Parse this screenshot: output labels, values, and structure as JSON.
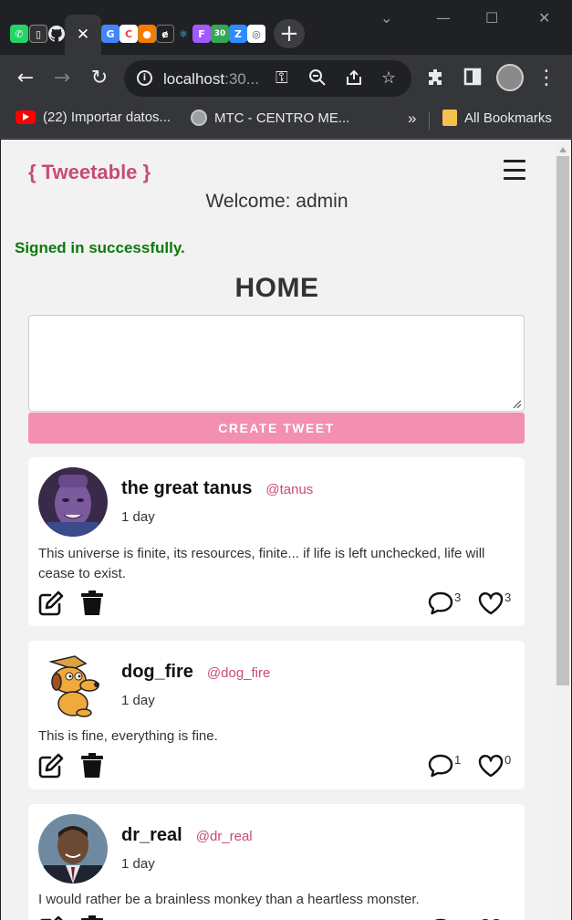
{
  "browser": {
    "active_tab_close": "✕",
    "new_tab": "+",
    "url_main": "localhost",
    "url_rest": ":30...",
    "bookmarks": [
      {
        "label": "(22) Importar datos..."
      },
      {
        "label": "MTC - CENTRO ME..."
      }
    ],
    "bookmarks_more": "»",
    "all_bookmarks": "All Bookmarks"
  },
  "app": {
    "brand": "{ Tweetable }",
    "welcome_prefix": "Welcome: ",
    "username": "admin",
    "flash": "Signed in successfully.",
    "page_title": "HOME",
    "tweet_input_value": "",
    "create_label": "CREATE TWEET"
  },
  "tweets": [
    {
      "name": "the great tanus",
      "handle": "@tanus",
      "age": "1 day",
      "body": "This universe is finite, its resources, finite... if life is left unchecked, life will cease to exist.",
      "comments": "3",
      "likes": "3"
    },
    {
      "name": "dog_fire",
      "handle": "@dog_fire",
      "age": "1 day",
      "body": "This is fine, everything is fine.",
      "comments": "1",
      "likes": "0"
    },
    {
      "name": "dr_real",
      "handle": "@dr_real",
      "age": "1 day",
      "body": "I would rather be a brainless monkey than a heartless monster."
    }
  ],
  "colors": {
    "brand": "#c74b76",
    "button": "#f38fb0",
    "flash": "#0a7a0a",
    "background": "#f2f2f2"
  }
}
